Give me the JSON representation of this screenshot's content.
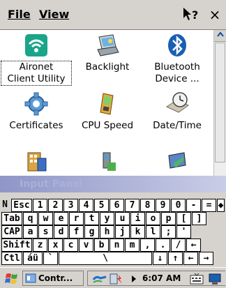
{
  "menubar": {
    "file_label": "File",
    "view_label": "View",
    "help_icon": "pointer-help-icon",
    "close_label": "×"
  },
  "items": [
    {
      "label1": "Aironet",
      "label2": "Client Utility",
      "icon": "wifi-icon"
    },
    {
      "label1": "Backlight",
      "label2": "",
      "icon": "laptop-icon"
    },
    {
      "label1": "Bluetooth",
      "label2": "Device ...",
      "icon": "bluetooth-icon"
    },
    {
      "label1": "Certificates",
      "label2": "",
      "icon": "gear-icon"
    },
    {
      "label1": "CPU Speed",
      "label2": "",
      "icon": "handheld-icon"
    },
    {
      "label1": "Date/Time",
      "label2": "",
      "icon": "clock-icon"
    },
    {
      "label1": "",
      "label2": "",
      "icon": "building-icon"
    },
    {
      "label1": "",
      "label2": "",
      "icon": "device-icon"
    },
    {
      "label1": "",
      "label2": "",
      "icon": "monitor-icon"
    }
  ],
  "input_panel": {
    "title": "Input Panel",
    "rows": [
      [
        "Esc",
        "1",
        "2",
        "3",
        "4",
        "5",
        "6",
        "7",
        "8",
        "9",
        "0",
        "-",
        "=",
        "◆"
      ],
      [
        "Tab",
        "q",
        "w",
        "e",
        "r",
        "t",
        "y",
        "u",
        "i",
        "o",
        "p",
        "[",
        "]"
      ],
      [
        "CAP",
        "a",
        "s",
        "d",
        "f",
        "g",
        "h",
        "j",
        "k",
        "l",
        ";",
        "'"
      ],
      [
        "Shift",
        "z",
        "x",
        "c",
        "v",
        "b",
        "n",
        "m",
        ",",
        ".",
        "/",
        "←"
      ],
      [
        "Ctl",
        "áü",
        "`",
        "\\",
        "↓",
        "↑",
        "←",
        "→"
      ]
    ],
    "row_marker": "N"
  },
  "taskbar": {
    "task_label": "Contr...",
    "clock": "6:07 AM"
  },
  "colors": {
    "menu_bg": "#d6d3ce",
    "panel_title_start": "#8f96c8",
    "panel_title_end": "#c9cde6",
    "accent_blue": "#1a5fb4"
  }
}
